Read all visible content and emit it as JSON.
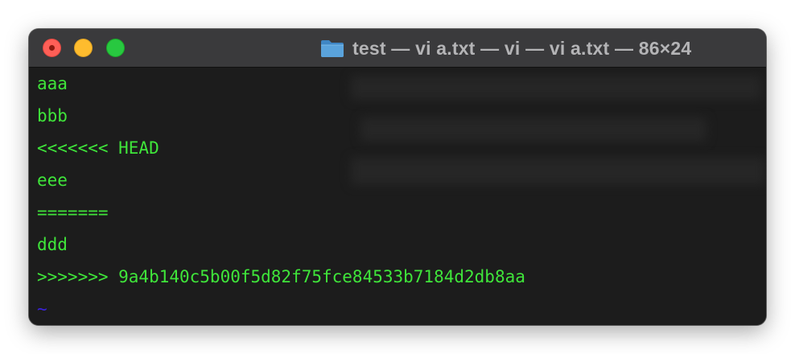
{
  "window": {
    "title": "test — vi a.txt — vi — vi a.txt — 86×24"
  },
  "icons": {
    "close": "close-icon",
    "minimize": "minimize-icon",
    "zoom": "zoom-icon",
    "folder": "folder-icon"
  },
  "colors": {
    "text": "#3fe53a",
    "tilde": "#3a22d8",
    "background": "#1c1c1c",
    "titlebar": "#3a3a3c"
  },
  "editor": {
    "lines": [
      "aaa",
      "bbb",
      "<<<<<<< HEAD",
      "eee",
      "=======",
      "ddd",
      ">>>>>>> 9a4b140c5b00f5d82f75fce84533b7184d2db8aa"
    ],
    "empty_marker": "~"
  }
}
